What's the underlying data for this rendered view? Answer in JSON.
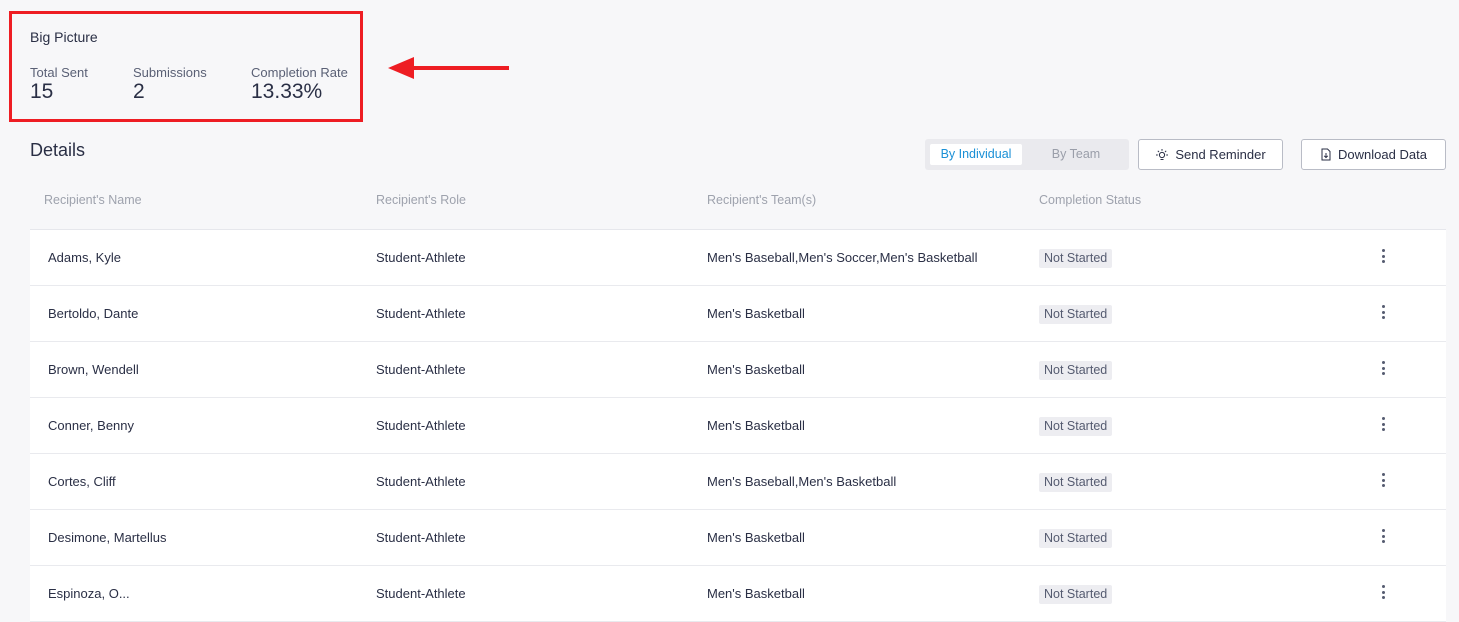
{
  "big_picture": {
    "title": "Big Picture",
    "stats": [
      {
        "label": "Total Sent",
        "value": "15"
      },
      {
        "label": "Submissions",
        "value": "2"
      },
      {
        "label": "Completion Rate",
        "value": "13.33%"
      }
    ]
  },
  "details": {
    "title": "Details",
    "toggle": {
      "by_individual": "By Individual",
      "by_team": "By Team",
      "active": "By Individual"
    },
    "send_reminder_label": "Send Reminder",
    "download_data_label": "Download Data",
    "columns": [
      "Recipient's Name",
      "Recipient's Role",
      "Recipient's Team(s)",
      "Completion Status"
    ],
    "rows": [
      {
        "name": "Adams, Kyle",
        "role": "Student-Athlete",
        "teams": "Men's Baseball,Men's Soccer,Men's Basketball",
        "status": "Not Started"
      },
      {
        "name": "Bertoldo, Dante",
        "role": "Student-Athlete",
        "teams": "Men's Basketball",
        "status": "Not Started"
      },
      {
        "name": "Brown, Wendell",
        "role": "Student-Athlete",
        "teams": "Men's Basketball",
        "status": "Not Started"
      },
      {
        "name": "Conner, Benny",
        "role": "Student-Athlete",
        "teams": "Men's Basketball",
        "status": "Not Started"
      },
      {
        "name": "Cortes, Cliff",
        "role": "Student-Athlete",
        "teams": "Men's Baseball,Men's Basketball",
        "status": "Not Started"
      },
      {
        "name": "Desimone, Martellus",
        "role": "Student-Athlete",
        "teams": "Men's Basketball",
        "status": "Not Started"
      },
      {
        "name": "Espinoza, O...",
        "role": "Student-Athlete",
        "teams": "Men's Basketball",
        "status": "Not Started"
      }
    ]
  },
  "colors": {
    "highlight": "#ee1d23",
    "accent": "#1a90d6",
    "text": "#2a2f45",
    "muted": "#9ea2ad",
    "badge_bg": "#ededf1"
  },
  "icons": {
    "arrow": "arrow-left-icon",
    "reminder": "lightbulb-icon",
    "download": "file-download-icon",
    "row_menu": "kebab-menu-icon"
  }
}
